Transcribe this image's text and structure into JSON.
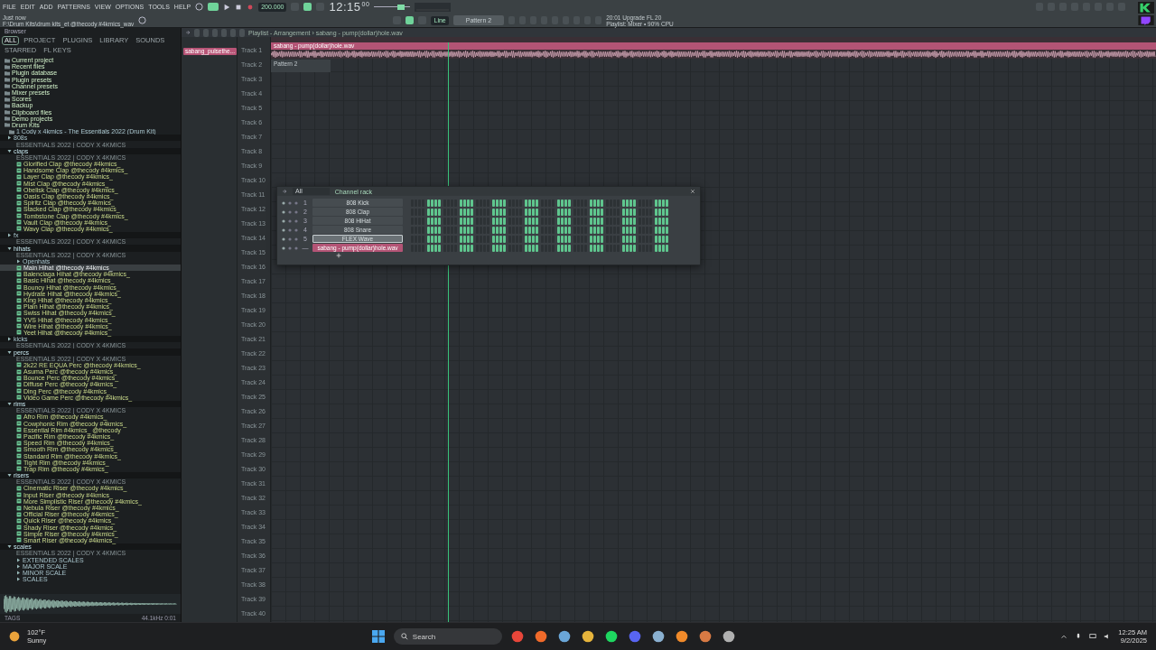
{
  "toolbar": {
    "menu": [
      "FILE",
      "EDIT",
      "ADD",
      "PATTERNS",
      "VIEW",
      "OPTIONS",
      "TOOLS",
      "HELP"
    ],
    "tempo": "200.000",
    "time": "12:15",
    "time_small": "00",
    "hint_title": "Just now",
    "hint": "F:\\Drum Kits\\drum kits_et @thecody #4kmics_wav",
    "snap": "Line",
    "pattern": "Pattern 2",
    "master_volume": {
      "level": 0.75
    },
    "news_title": "20:01 Upgrade FL 20",
    "news": "Playlist: Mixer • 90% CPU"
  },
  "browser": {
    "title": "Browser",
    "tabs": [
      {
        "label": "ALL",
        "selected": true
      },
      {
        "label": "PROJECT",
        "selected": false
      },
      {
        "label": "PLUGINS",
        "selected": false
      },
      {
        "label": "LIBRARY",
        "selected": false
      },
      {
        "label": "SOUNDS",
        "selected": false
      },
      {
        "label": "STARRED",
        "selected": false
      },
      {
        "label": "FL KEYS",
        "selected": false
      }
    ],
    "locations": [
      "Current project",
      "Recent files",
      "Plugin database",
      "Plugin presets",
      "Channel presets",
      "Mixer presets",
      "Scores",
      "Backup",
      "Clipboard files",
      "Demo projects",
      "Drum Kits"
    ],
    "kit": "1 Cody x 4kmics - The Essentials 2022 (Drum Kit)",
    "tree": [
      {
        "kind": "folder",
        "name": "808s",
        "subtitle": "ESSENTIALS 2022 | CODY X 4KMICS",
        "expanded": false
      },
      {
        "kind": "folder",
        "name": "claps",
        "subtitle": "ESSENTIALS 2022 | CODY X 4KMICS",
        "expanded": true,
        "children": [
          {
            "kind": "file",
            "name": "Glorified Clap @thecody #4kmics_",
            "selected": false
          },
          {
            "kind": "file",
            "name": "Handsome Clap @thecody #4kmics_",
            "selected": false
          },
          {
            "kind": "file",
            "name": "Layer Clap @thecody #4kmics_",
            "selected": false
          },
          {
            "kind": "file",
            "name": "Mist Clap @thecody #4kmics_",
            "selected": false
          },
          {
            "kind": "file",
            "name": "Obelisk Clap @thecody #4kmics_",
            "selected": false
          },
          {
            "kind": "file",
            "name": "Oasis Clap @thecody #4kmics_",
            "selected": false
          },
          {
            "kind": "file",
            "name": "Spiritz Clap @thecody #4kmics_",
            "selected": false
          },
          {
            "kind": "file",
            "name": "Stacked Clap @thecody #4kmics_",
            "selected": false
          },
          {
            "kind": "file",
            "name": "Tombstone Clap @thecody #4kmics_",
            "selected": false
          },
          {
            "kind": "file",
            "name": "Vault Clap @thecody #4kmics_",
            "selected": false
          },
          {
            "kind": "file",
            "name": "Wavy Clap @thecody #4kmics_",
            "selected": false
          }
        ]
      },
      {
        "kind": "folder",
        "name": "fx",
        "subtitle": "ESSENTIALS 2022 | CODY X 4KMICS",
        "expanded": false
      },
      {
        "kind": "folder",
        "name": "hihats",
        "subtitle": "ESSENTIALS 2022 | CODY X 4KMICS",
        "expanded": true,
        "children": [
          {
            "kind": "folder",
            "name": "Openhats",
            "expanded": false
          },
          {
            "kind": "file",
            "name": "Main Hihat @thecody #4kmics_",
            "selected": true
          },
          {
            "kind": "file",
            "name": "Balenciaga Hihat @thecody #4kmics_",
            "selected": false
          },
          {
            "kind": "file",
            "name": "Basic Hihat @thecody #4kmics_",
            "selected": false
          },
          {
            "kind": "file",
            "name": "Bouncy Hihat @thecody #4kmics_",
            "selected": false
          },
          {
            "kind": "file",
            "name": "Hydrate Hihat @thecody #4kmics_",
            "selected": false
          },
          {
            "kind": "file",
            "name": "King Hihat @thecody #4kmics_",
            "selected": false
          },
          {
            "kind": "file",
            "name": "Plain Hihat @thecody #4kmics_",
            "selected": false
          },
          {
            "kind": "file",
            "name": "Swiss Hihat @thecody #4kmics_",
            "selected": false
          },
          {
            "kind": "file",
            "name": "YVS Hihat @thecody #4kmics_",
            "selected": false
          },
          {
            "kind": "file",
            "name": "Wire Hihat @thecody #4kmics_",
            "selected": false
          },
          {
            "kind": "file",
            "name": "Yeet Hihat @thecody #4kmics_",
            "selected": false
          }
        ]
      },
      {
        "kind": "folder",
        "name": "kicks",
        "subtitle": "ESSENTIALS 2022 | CODY X 4KMICS",
        "expanded": false
      },
      {
        "kind": "folder",
        "name": "percs",
        "subtitle": "ESSENTIALS 2022 | CODY X 4KMICS",
        "expanded": true,
        "children": [
          {
            "kind": "file",
            "name": "2k22 RE EQUA Perc @thecody #4kmics_",
            "selected": false
          },
          {
            "kind": "file",
            "name": "Asuma Perc @thecody #4kmics_",
            "selected": false
          },
          {
            "kind": "file",
            "name": "Bounce Perc @thecody #4kmics_",
            "selected": false
          },
          {
            "kind": "file",
            "name": "Diffuse Perc @thecody #4kmics_",
            "selected": false
          },
          {
            "kind": "file",
            "name": "Ding Perc @thecody #4kmics_",
            "selected": false
          },
          {
            "kind": "file",
            "name": "Video Game Perc @thecody #4kmics_",
            "selected": false
          }
        ]
      },
      {
        "kind": "folder",
        "name": "rims",
        "subtitle": "ESSENTIALS 2022 | CODY X 4KMICS",
        "expanded": true,
        "children": [
          {
            "kind": "file",
            "name": "Afro Rim @thecody #4kmics_",
            "selected": false
          },
          {
            "kind": "file",
            "name": "Cowphonic Rim @thecody #4kmics_",
            "selected": false
          },
          {
            "kind": "file",
            "name": "Essential Rim #4kmics_ @thecody",
            "selected": false
          },
          {
            "kind": "file",
            "name": "Pacific Rim @thecody #4kmics_",
            "selected": false
          },
          {
            "kind": "file",
            "name": "Speed Rim @thecody #4kmics_",
            "selected": false
          },
          {
            "kind": "file",
            "name": "Smooth Rim @thecody #4kmics_",
            "selected": false
          },
          {
            "kind": "file",
            "name": "Standard Rim @thecody #4kmics_",
            "selected": false
          },
          {
            "kind": "file",
            "name": "Tight Rim @thecody #4kmics_",
            "selected": false
          },
          {
            "kind": "file",
            "name": "Trap Rim @thecody #4kmics_",
            "selected": false
          }
        ]
      },
      {
        "kind": "folder",
        "name": "risers",
        "subtitle": "ESSENTIALS 2022 | CODY X 4KMICS",
        "expanded": true,
        "children": [
          {
            "kind": "file",
            "name": "Cinematic Riser @thecody #4kmics_",
            "selected": false
          },
          {
            "kind": "file",
            "name": "Input Riser @thecody #4kmics_",
            "selected": false
          },
          {
            "kind": "file",
            "name": "More Simplistic Riser @thecody #4kmics_",
            "selected": false
          },
          {
            "kind": "file",
            "name": "Nebula Riser @thecody #4kmics_",
            "selected": false
          },
          {
            "kind": "file",
            "name": "Official Riser @thecody #4kmics_",
            "selected": false
          },
          {
            "kind": "file",
            "name": "Quick Riser @thecody #4kmics_",
            "selected": false
          },
          {
            "kind": "file",
            "name": "Shady Riser @thecody #4kmics_",
            "selected": false
          },
          {
            "kind": "file",
            "name": "Simple Riser @thecody #4kmics_",
            "selected": false
          },
          {
            "kind": "file",
            "name": "Smart Riser @thecody #4kmics_",
            "selected": false
          }
        ]
      },
      {
        "kind": "folder",
        "name": "scales",
        "subtitle": "ESSENTIALS 2022 | CODY X 4KMICS",
        "expanded": true,
        "children": [
          {
            "kind": "folder",
            "name": "EXTENDED SCALES",
            "expanded": false
          },
          {
            "kind": "folder",
            "name": "MAJOR SCALE",
            "expanded": false
          },
          {
            "kind": "folder",
            "name": "MINOR SCALE",
            "expanded": false
          },
          {
            "kind": "folder",
            "name": "SCALES",
            "expanded": false
          }
        ]
      }
    ],
    "status": "TAGS",
    "duration": "44.1kHz 0:01"
  },
  "playlist": {
    "title": "Playlist - Arrangement › sabang - pump(dollar)hole.wav",
    "picker_item": "sabang_pulsethe...",
    "audio_clip": "sabang - pump(dollar)hole.wav",
    "pattern_clip": "Pattern 2",
    "tracks": [
      "Track 1",
      "Track 2",
      "Track 3",
      "Track 4",
      "Track 5",
      "Track 6",
      "Track 7",
      "Track 8",
      "Track 9",
      "Track 10",
      "Track 11",
      "Track 12",
      "Track 13",
      "Track 14",
      "Track 15",
      "Track 16",
      "Track 17",
      "Track 18",
      "Track 19",
      "Track 20",
      "Track 21",
      "Track 22",
      "Track 23",
      "Track 24",
      "Track 25",
      "Track 26",
      "Track 27",
      "Track 28",
      "Track 29",
      "Track 30",
      "Track 31",
      "Track 32",
      "Track 33",
      "Track 34",
      "Track 35",
      "Track 36",
      "Track 37",
      "Track 38",
      "Track 39",
      "Track 40"
    ]
  },
  "channel_rack": {
    "title": "Channel rack",
    "filter": "All",
    "channels": [
      {
        "number": "1",
        "name": "808 Kick",
        "selected": false,
        "kind": "instrument"
      },
      {
        "number": "2",
        "name": "808 Clap",
        "selected": false,
        "kind": "instrument"
      },
      {
        "number": "3",
        "name": "808 HiHat",
        "selected": false,
        "kind": "instrument"
      },
      {
        "number": "4",
        "name": "808 Snare",
        "selected": false,
        "kind": "instrument"
      },
      {
        "number": "5",
        "name": "FLEX Wave",
        "selected": true,
        "kind": "instrument"
      },
      {
        "number": "—",
        "name": "sabang - pump(dollar)hole.wav",
        "selected": false,
        "kind": "audio"
      }
    ]
  },
  "taskbar": {
    "temperature": "102°F",
    "weather": "Sunny",
    "search": "Search",
    "time": "12:25 AM",
    "date": "9/2/2025"
  }
}
